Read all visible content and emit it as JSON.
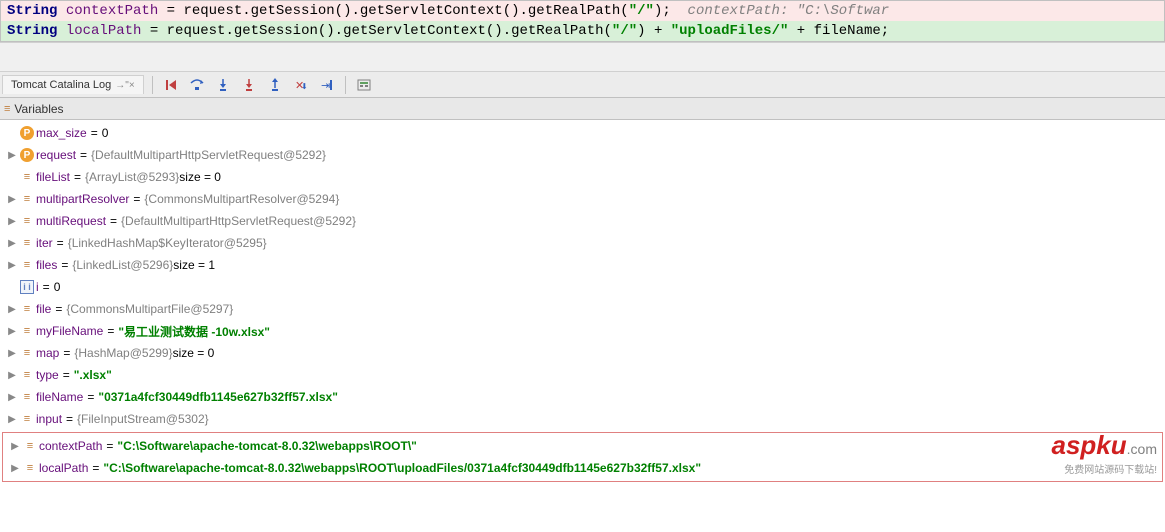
{
  "code": {
    "line1": {
      "type": "String ",
      "var": "contextPath",
      "rest": " = request.getSession().getServletContext().getRealPath(",
      "arg": "\"/\"",
      "after": ");  ",
      "inlineVar": "contextPath: ",
      "inlineVal": "\"C:\\Softwar"
    },
    "line2": {
      "type": "String ",
      "var": "localPath",
      "rest": " = request.getSession().getServletContext().getRealPath(",
      "arg": "\"/\"",
      "after": ") + ",
      "str2": "\"uploadFiles/\"",
      "after2": " + fileName;"
    }
  },
  "tab": {
    "label": "Tomcat Catalina Log",
    "pin": "→\"×"
  },
  "panel": {
    "title": "Variables"
  },
  "vars": [
    {
      "icon": "p",
      "name": "max_size",
      "val": "0",
      "style": "black",
      "arrow": ""
    },
    {
      "icon": "p",
      "name": "request",
      "val": "{DefaultMultipartHttpServletRequest@5292}",
      "style": "gray",
      "arrow": "▶"
    },
    {
      "icon": "bars",
      "name": "fileList",
      "val": "{ArrayList@5293}",
      "style": "gray",
      "suffix": "  size = 0",
      "arrow": ""
    },
    {
      "icon": "bars",
      "name": "multipartResolver",
      "val": "{CommonsMultipartResolver@5294}",
      "style": "gray",
      "arrow": "▶"
    },
    {
      "icon": "bars",
      "name": "multiRequest",
      "val": "{DefaultMultipartHttpServletRequest@5292}",
      "style": "gray",
      "arrow": "▶"
    },
    {
      "icon": "bars",
      "name": "iter",
      "val": "{LinkedHashMap$KeyIterator@5295}",
      "style": "gray",
      "arrow": "▶"
    },
    {
      "icon": "bars",
      "name": "files",
      "val": "{LinkedList@5296}",
      "style": "gray",
      "suffix": "  size = 1",
      "arrow": "▶"
    },
    {
      "icon": "ii",
      "name": "i",
      "val": "0",
      "style": "black",
      "arrow": ""
    },
    {
      "icon": "bars",
      "name": "file",
      "val": "{CommonsMultipartFile@5297}",
      "style": "gray",
      "arrow": "▶"
    },
    {
      "icon": "bars",
      "name": "myFileName",
      "val": "\"易工业测试数据 -10w.xlsx\"",
      "style": "green",
      "arrow": "▶"
    },
    {
      "icon": "bars",
      "name": "map",
      "val": "{HashMap@5299}",
      "style": "gray",
      "suffix": "  size = 0",
      "arrow": "▶"
    },
    {
      "icon": "bars",
      "name": "type",
      "val": "\".xlsx\"",
      "style": "green",
      "arrow": "▶"
    },
    {
      "icon": "bars",
      "name": "fileName",
      "val": "\"0371a4fcf30449dfb1145e627b32ff57.xlsx\"",
      "style": "green",
      "arrow": "▶"
    },
    {
      "icon": "bars",
      "name": "input",
      "val": "{FileInputStream@5302}",
      "style": "gray",
      "arrow": "▶"
    }
  ],
  "highlighted": [
    {
      "icon": "bars",
      "name": "contextPath",
      "val": "\"C:\\Software\\apache-tomcat-8.0.32\\webapps\\ROOT\\\"",
      "style": "green",
      "arrow": "▶"
    },
    {
      "icon": "bars",
      "name": "localPath",
      "val": "\"C:\\Software\\apache-tomcat-8.0.32\\webapps\\ROOT\\uploadFiles/0371a4fcf30449dfb1145e627b32ff57.xlsx\"",
      "style": "green",
      "arrow": "▶"
    }
  ],
  "watermark": {
    "brand": "aspku",
    "suffix": ".com",
    "tagline": "免费网站源码下载站!"
  }
}
